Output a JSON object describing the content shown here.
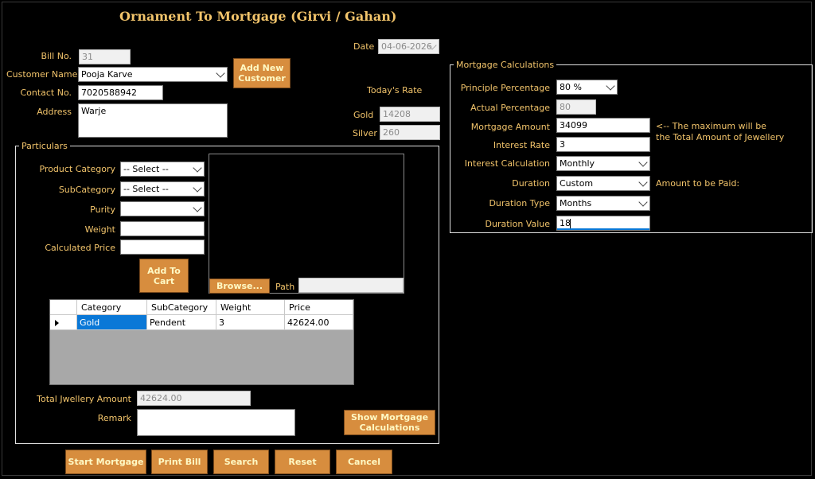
{
  "form": {
    "title": "Ornament To Mortgage (Girvi / Gahan)"
  },
  "date": {
    "label": "Date",
    "value": "04-06-2026"
  },
  "bill": {
    "label": "Bill No.",
    "value": "31"
  },
  "customer": {
    "name_label": "Customer Name",
    "name_value": "Pooja Karve",
    "contact_label": "Contact No.",
    "contact_value": "7020588942",
    "address_label": "Address",
    "address_value": "Warje",
    "add_new_label": "Add New Customer"
  },
  "rates": {
    "heading": "Today's Rate",
    "gold_label": "Gold",
    "gold_value": "14208",
    "silver_label": "Silver",
    "silver_value": "260"
  },
  "particulars": {
    "group_label": "Particulars",
    "product_category_label": "Product Category",
    "product_category_value": "-- Select --",
    "subcategory_label": "SubCategory",
    "subcategory_value": "-- Select --",
    "purity_label": "Purity",
    "purity_value": "",
    "weight_label": "Weight",
    "weight_value": "",
    "calc_price_label": "Calculated Price",
    "calc_price_value": "",
    "add_to_cart_label": "Add To Cart",
    "browse_label": "Browse...",
    "path_label": "Path",
    "path_value": ""
  },
  "cart": {
    "headers": [
      "Category",
      "SubCategory",
      "Weight",
      "Price"
    ],
    "rows": [
      [
        "Gold",
        "Pendent",
        "3",
        "42624.00"
      ]
    ]
  },
  "totals": {
    "total_label": "Total Jwellery Amount",
    "total_value": "42624.00",
    "remark_label": "Remark",
    "remark_value": "",
    "show_calc_label": "Show Mortgage Calculations"
  },
  "mortgage": {
    "group_label": "Mortgage Calculations",
    "principle_pct_label": "Principle Percentage",
    "principle_pct_value": "80 %",
    "actual_pct_label": "Actual Percentage",
    "actual_pct_value": "80",
    "amount_label": "Mortgage Amount",
    "amount_value": "34099",
    "note_line1": "<-- The maximum will be",
    "note_line2": "the Total Amount of Jewellery",
    "interest_rate_label": "Interest Rate",
    "interest_rate_value": "3",
    "interest_calc_label": "Interest Calculation",
    "interest_calc_value": "Monthly",
    "duration_label": "Duration",
    "duration_value": "Custom",
    "amount_to_pay_label": "Amount to be Paid:",
    "duration_type_label": "Duration Type",
    "duration_type_value": "Months",
    "duration_val_label": "Duration Value",
    "duration_val_value": "18"
  },
  "actions": {
    "start_label": "Start Mortgage",
    "print_label": "Print Bill",
    "search_label": "Search",
    "reset_label": "Reset",
    "cancel_label": "Cancel"
  },
  "colors": {
    "background": "#000000",
    "label_text": "#f2c46b",
    "button_bg": "#d78d3e",
    "button_text": "#fff9c4",
    "selection": "#0a78d7"
  }
}
